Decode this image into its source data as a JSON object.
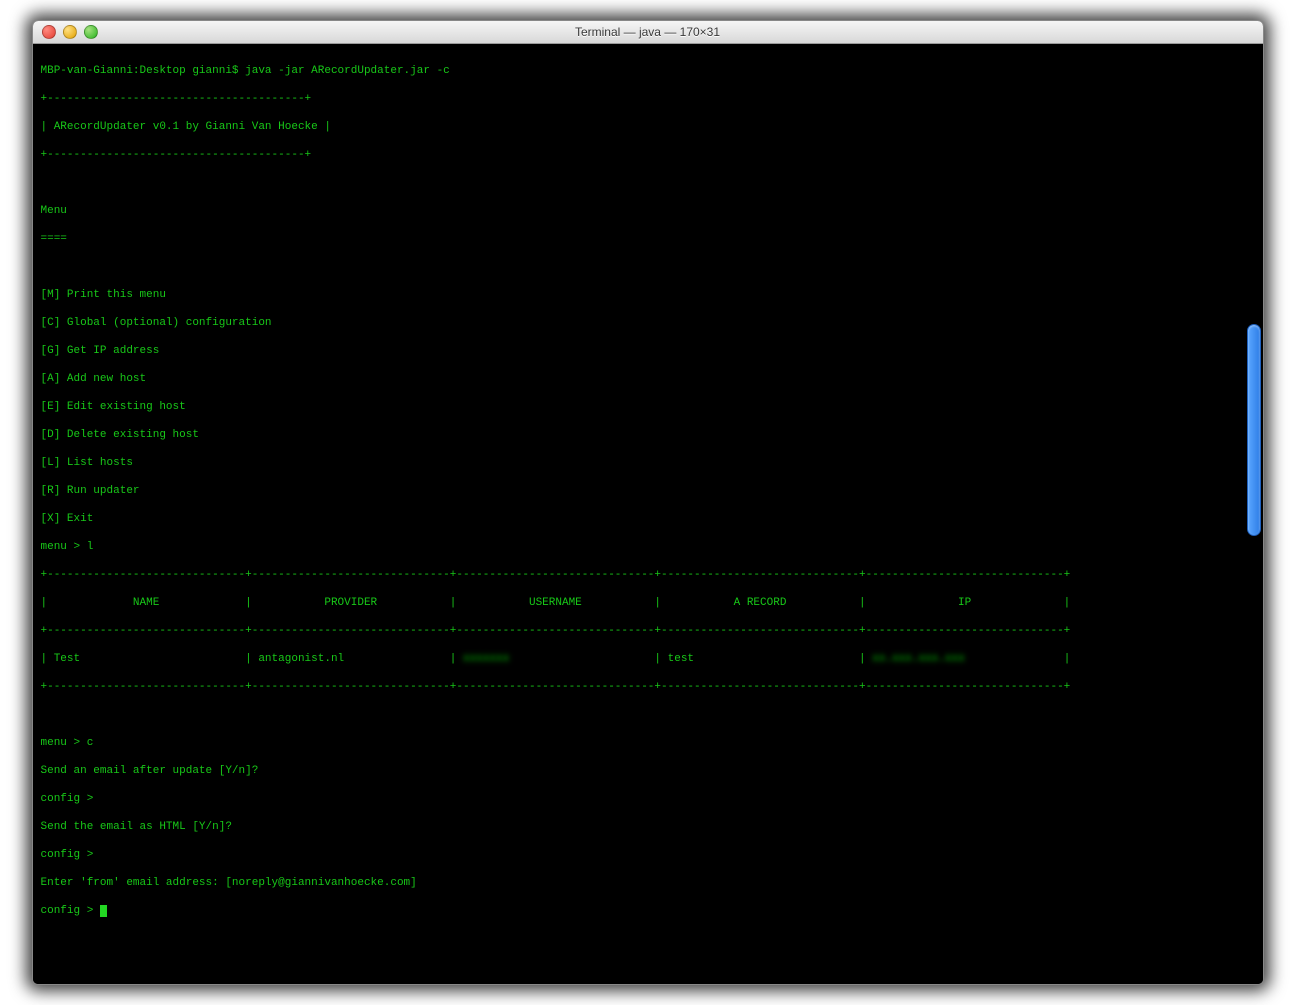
{
  "window": {
    "title": "Terminal — java — 170×31"
  },
  "prompt": "MBP-van-Gianni:Desktop gianni$ java -jar ARecordUpdater.jar -c",
  "box_border": "+---------------------------------------+",
  "box_line": "| ARecordUpdater v0.1 by Gianni Van Hoecke |",
  "menu_header": "Menu",
  "menu_underline": "====",
  "menu_items": [
    "[M] Print this menu",
    "[C] Global (optional) configuration",
    "[G] Get IP address",
    "[A] Add new host",
    "[E] Edit existing host",
    "[D] Delete existing host",
    "[L] List hosts",
    "[R] Run updater",
    "[X] Exit"
  ],
  "menu_prompt_l": "menu > l",
  "chart_data": {
    "type": "table",
    "columns": [
      "NAME",
      "PROVIDER",
      "USERNAME",
      "A RECORD",
      "IP"
    ],
    "rows": [
      {
        "name": "Test",
        "provider": "antagonist.nl",
        "username": "██████",
        "a_record": "test",
        "ip": "██.███.███.███"
      }
    ]
  },
  "table_border": "+------------------------------+------------------------------+------------------------------+------------------------------+------------------------------+",
  "table_head": "|             NAME             |           PROVIDER           |           USERNAME           |           A RECORD           |              IP              |",
  "table_row_left": "| Test                         | antagonist.nl                | ",
  "table_row_user_blur": "xxxxxxx",
  "table_row_mid": "                      | test                         | ",
  "table_row_ip_blur": "xx.xxx.xxx.xxx",
  "table_row_end": "               |",
  "menu_prompt_c": "menu > c",
  "config_q1": "Send an email after update [Y/n]?",
  "config_p1": "config >",
  "config_q2": "Send the email as HTML [Y/n]?",
  "config_p2": "config >",
  "config_q3": "Enter 'from' email address: [noreply@giannivanhoecke.com]",
  "config_p3": "config > "
}
